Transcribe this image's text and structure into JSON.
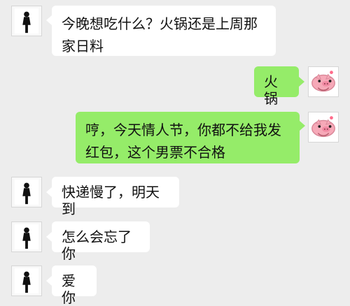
{
  "messages": [
    {
      "direction": "incoming",
      "text": "今晚想吃什么？火锅还是上周那家日料",
      "avatar_icon": "man-avatar-icon"
    },
    {
      "direction": "outgoing",
      "text": "火锅",
      "avatar_icon": "pig-avatar-icon"
    },
    {
      "direction": "outgoing",
      "text": "哼，今天情人节，你都不给我发红包，这个男票不合格",
      "avatar_icon": "pig-avatar-icon"
    },
    {
      "direction": "incoming",
      "text": "快递慢了，明天到",
      "avatar_icon": "man-avatar-icon"
    },
    {
      "direction": "incoming",
      "text": "怎么会忘了你",
      "avatar_icon": "man-avatar-icon"
    },
    {
      "direction": "incoming",
      "text": "爱你",
      "avatar_icon": "man-avatar-icon"
    }
  ],
  "colors": {
    "background": "#ededed",
    "incoming_bubble": "#ffffff",
    "outgoing_bubble": "#95ec69",
    "text": "#111111"
  }
}
